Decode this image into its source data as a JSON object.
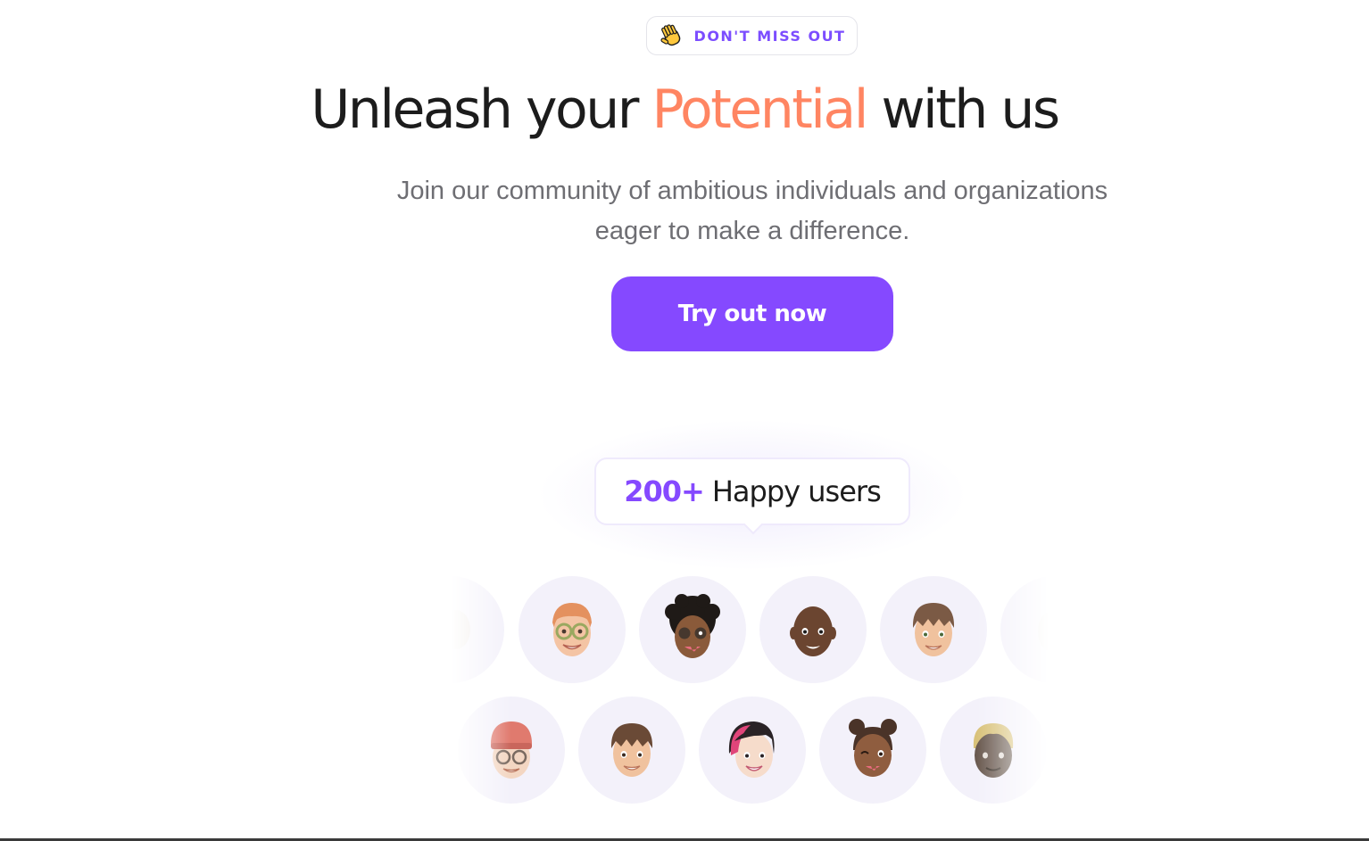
{
  "badge": {
    "text": "DON'T MISS OUT",
    "icon": "waving-hand-icon"
  },
  "headline": {
    "part1": "Unleash your ",
    "highlight": "Potential",
    "part2": " with us"
  },
  "subtitle": {
    "line1": "Join our community of ambitious individuals and organizations",
    "line2": "eager to make a difference."
  },
  "cta": {
    "label": "Try out now"
  },
  "users": {
    "count": "200+",
    "label": "Happy users"
  },
  "colors": {
    "accent": "#8549ff",
    "highlight": "#ff8562",
    "text": "#1c1c1c",
    "muted": "#6e6e73",
    "avatar_bg": "#f3f1fa"
  },
  "avatars": {
    "row1": [
      {
        "icon": "memoji-faded-icon"
      },
      {
        "icon": "memoji-glasses-redhead-icon"
      },
      {
        "icon": "memoji-curly-hair-icon"
      },
      {
        "icon": "memoji-bald-man-icon"
      },
      {
        "icon": "memoji-bowl-cut-boy-icon"
      },
      {
        "icon": "memoji-faded-icon"
      }
    ],
    "row2": [
      {
        "icon": "memoji-beanie-glasses-icon"
      },
      {
        "icon": "memoji-bowl-cut-boy-icon"
      },
      {
        "icon": "memoji-pink-hair-girl-icon"
      },
      {
        "icon": "memoji-buns-winking-girl-icon"
      },
      {
        "icon": "memoji-blond-man-icon"
      }
    ]
  }
}
